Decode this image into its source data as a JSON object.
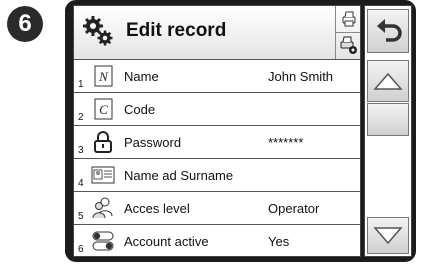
{
  "step_badge": "6",
  "header": {
    "title": "Edit record",
    "icon": "gears-icon",
    "tools": [
      "print-icon",
      "print-settings-icon"
    ]
  },
  "rows": [
    {
      "num": "1",
      "icon": "name-icon",
      "label": "Name",
      "value": "John Smith"
    },
    {
      "num": "2",
      "icon": "code-icon",
      "label": "Code",
      "value": ""
    },
    {
      "num": "3",
      "icon": "lock-icon",
      "label": "Password",
      "value": "*******"
    },
    {
      "num": "4",
      "icon": "id-card-icon",
      "label": "Name ad Surname",
      "value": ""
    },
    {
      "num": "5",
      "icon": "users-icon",
      "label": "Acces level",
      "value": "Operator"
    },
    {
      "num": "6",
      "icon": "toggle-icon",
      "label": "Account active",
      "value": "Yes"
    }
  ],
  "sidebar": {
    "buttons": [
      "back-icon",
      "scroll-up-icon",
      "blank",
      "scroll-down-icon"
    ]
  },
  "colors": {
    "frame": "#1c1c1c",
    "button_top": "#f3f3f3",
    "button_bottom": "#d0d0d0"
  }
}
